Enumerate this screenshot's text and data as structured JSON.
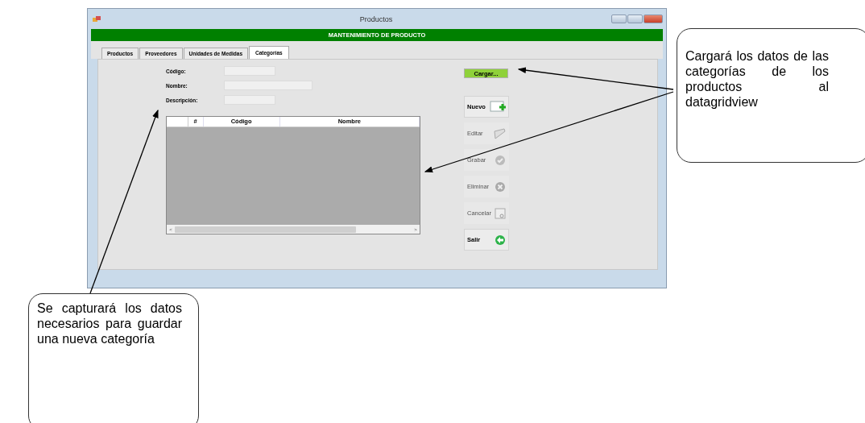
{
  "window": {
    "title": "Productos"
  },
  "banner": "MANTENIMIENTO DE PRODUCTO",
  "tabs": [
    {
      "label": "Productos",
      "selected": false
    },
    {
      "label": "Proveedores",
      "selected": false
    },
    {
      "label": "Unidades de Medidas",
      "selected": false
    },
    {
      "label": "Categorías",
      "selected": true
    }
  ],
  "form": {
    "fields": [
      {
        "label": "Código:"
      },
      {
        "label": "Nombre:"
      },
      {
        "label": "Descripción:"
      }
    ]
  },
  "grid": {
    "columns": [
      {
        "label": "#",
        "kind": "narrow"
      },
      {
        "label": "Código",
        "kind": "medium"
      },
      {
        "label": "Nombre",
        "kind": "wide"
      }
    ],
    "scroll_left": "<",
    "scroll_right": ">"
  },
  "load_button": {
    "label": "Cargar..."
  },
  "buttons": [
    {
      "label": "Nuevo",
      "kind": "new",
      "disabled": false
    },
    {
      "label": "Editar",
      "kind": "edit",
      "disabled": true
    },
    {
      "label": "Grabar",
      "kind": "save",
      "disabled": true
    },
    {
      "label": "Eliminar",
      "kind": "delete",
      "disabled": true
    },
    {
      "label": "Cancelar",
      "kind": "cancel",
      "disabled": true
    },
    {
      "label": "Salir",
      "kind": "exit",
      "disabled": false
    }
  ],
  "callouts": [
    {
      "text": "Cargará los datos de las categorías de los productos al datagridview"
    },
    {
      "text": "Se capturará los datos necesarios para guardar una nueva categoría"
    }
  ]
}
